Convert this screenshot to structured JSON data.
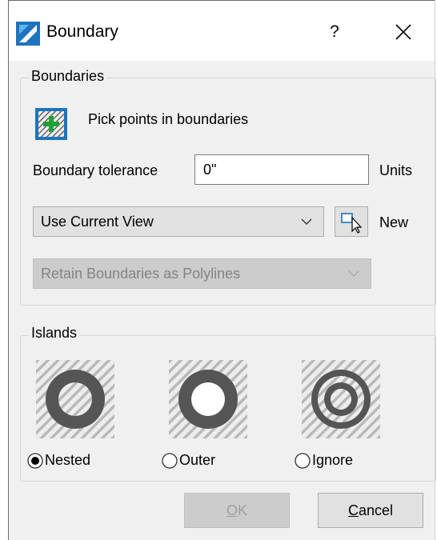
{
  "window": {
    "title": "Boundary",
    "help_label": "?",
    "icon": "bricscad-logo-icon",
    "accent_color": "#1e73be"
  },
  "boundaries": {
    "group_label": "Boundaries",
    "pick_points_label": "Pick points in boundaries",
    "tolerance_label": "Boundary tolerance",
    "tolerance_value": "0\"",
    "units_label": "Units",
    "view_select_value": "Use Current View",
    "new_label": "New",
    "retain_select_value": "Retain Boundaries as Polylines"
  },
  "islands": {
    "group_label": "Islands",
    "options": [
      {
        "label": "Nested",
        "selected": true
      },
      {
        "label": "Outer",
        "selected": false
      },
      {
        "label": "Ignore",
        "selected": false
      }
    ]
  },
  "buttons": {
    "ok_first": "O",
    "ok_rest": "K",
    "cancel_first": "C",
    "cancel_rest": "ancel"
  }
}
